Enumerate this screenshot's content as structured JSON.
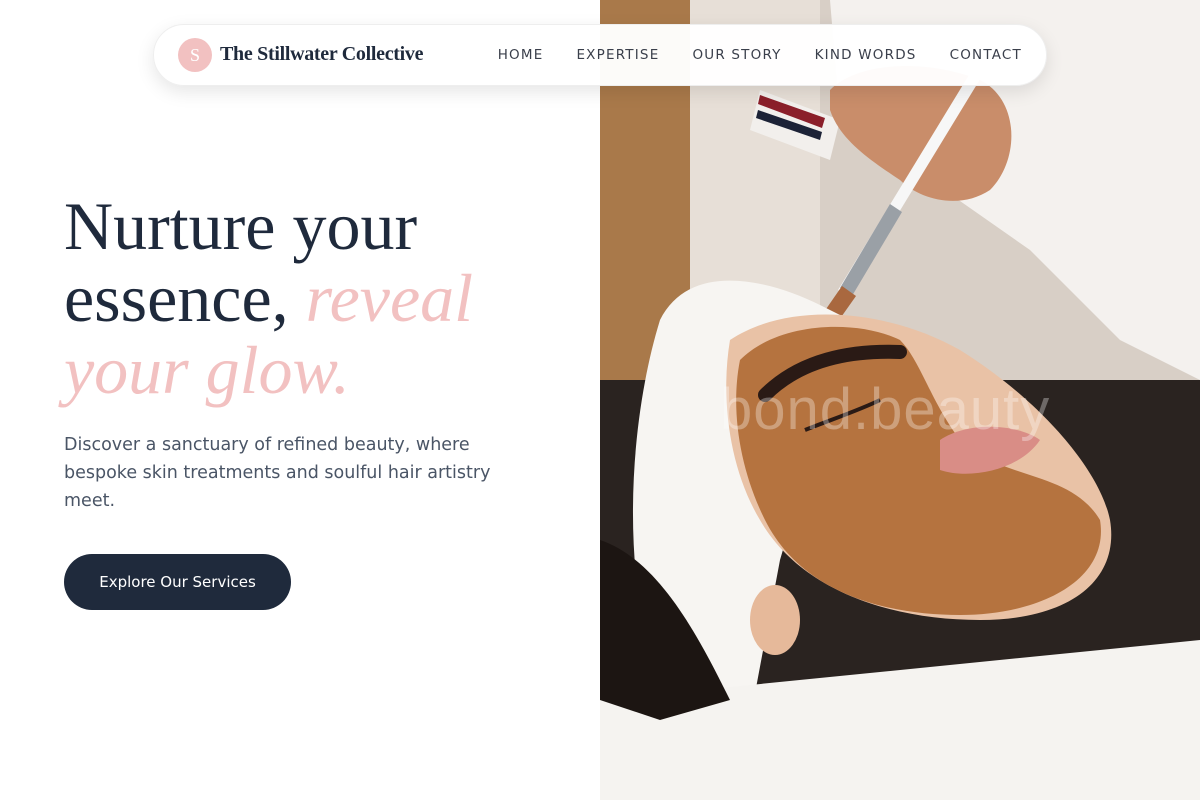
{
  "brand": {
    "initial": "S",
    "name": "The Stillwater Collective"
  },
  "nav": {
    "items": [
      "HOME",
      "EXPERTISE",
      "OUR STORY",
      "KIND WORDS",
      "CONTACT"
    ]
  },
  "hero": {
    "headline_line1": "Nurture your",
    "headline_line2_plain": "essence, ",
    "headline_line2_accent": "reveal",
    "headline_line3_accent": "your glow.",
    "subcopy": "Discover a sanctuary of refined beauty, where bespoke skin treatments and soulful hair artistry meet.",
    "cta_label": "Explore Our Services",
    "image_watermark": "bond.beauty"
  },
  "colors": {
    "navy": "#1f2a3c",
    "blush": "#f2c1c1",
    "body_text": "#4a5566"
  }
}
